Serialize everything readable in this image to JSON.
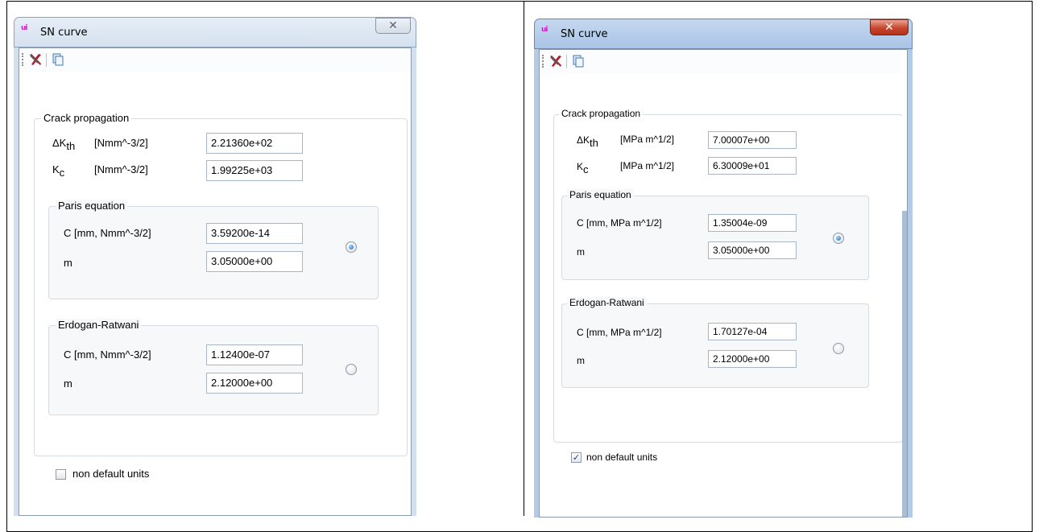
{
  "windows": [
    {
      "title": "SN curve",
      "close_glyph": "✕",
      "app_icon": "ui",
      "toolbar_icons": [
        "tools-icon",
        "copy-icon"
      ],
      "crack": {
        "legend": "Crack propagation",
        "dk_symbol": "ΔK",
        "dk_sub": "th",
        "dk_unit": "[Nmm^-3/2]",
        "dk_value": "2.21360e+02",
        "kc_symbol": "K",
        "kc_sub": "c",
        "kc_unit": "[Nmm^-3/2]",
        "kc_value": "1.99225e+03"
      },
      "paris": {
        "legend": "Paris equation",
        "c_label": "C  [mm, Nmm^-3/2]",
        "c_value": "3.59200e-14",
        "m_label": "m",
        "m_value": "3.05000e+00",
        "selected": true
      },
      "erdogan": {
        "legend": "Erdogan-Ratwani",
        "c_label": "C  [mm, Nmm^-3/2]",
        "c_value": "1.12400e-07",
        "m_label": "m",
        "m_value": "2.12000e+00",
        "selected": false
      },
      "non_default_units": {
        "label": "non default units",
        "checked": false
      }
    },
    {
      "title": "SN curve",
      "close_glyph": "✕",
      "app_icon": "ui",
      "toolbar_icons": [
        "tools-icon",
        "copy-icon"
      ],
      "crack": {
        "legend": "Crack propagation",
        "dk_symbol": "ΔK",
        "dk_sub": "th",
        "dk_unit": "[MPa m^1/2]",
        "dk_value": "7.00007e+00",
        "kc_symbol": "K",
        "kc_sub": "c",
        "kc_unit": "[MPa m^1/2]",
        "kc_value": "6.30009e+01"
      },
      "paris": {
        "legend": "Paris equation",
        "c_label": "C  [mm, MPa m^1/2]",
        "c_value": "1.35004e-09",
        "m_label": "m",
        "m_value": "3.05000e+00",
        "selected": true
      },
      "erdogan": {
        "legend": "Erdogan-Ratwani",
        "c_label": "C  [mm, MPa m^1/2]",
        "c_value": "1.70127e-04",
        "m_label": "m",
        "m_value": "2.12000e+00",
        "selected": false
      },
      "non_default_units": {
        "label": "non default units",
        "checked": true
      }
    }
  ]
}
